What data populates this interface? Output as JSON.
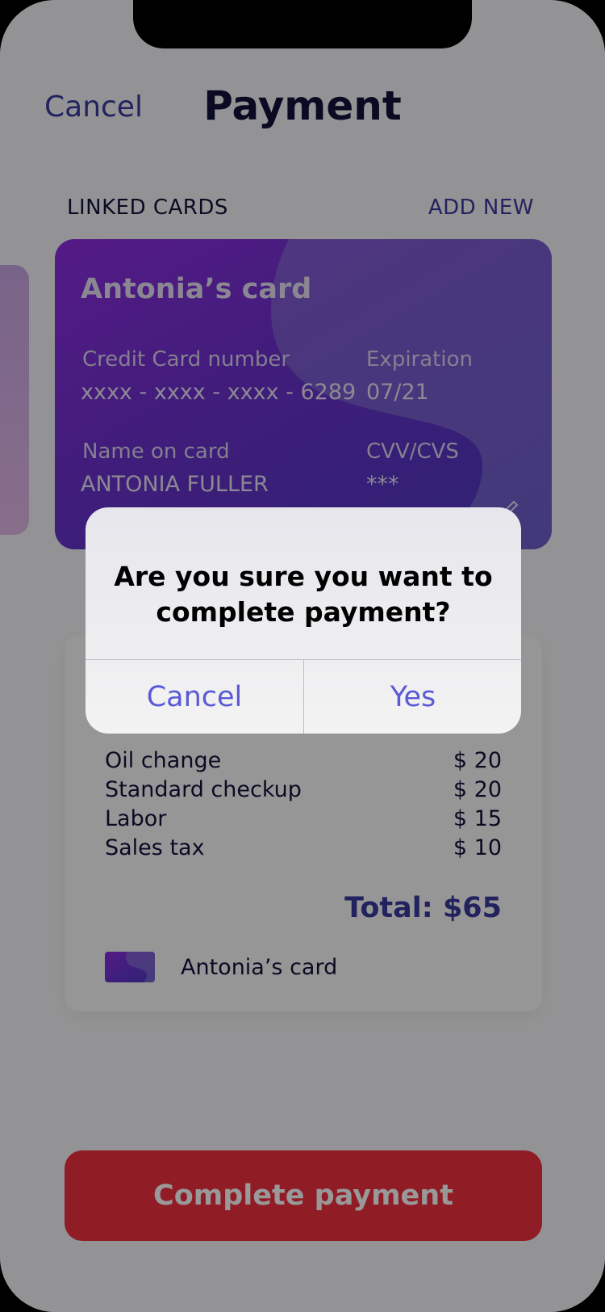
{
  "header": {
    "cancel_label": "Cancel",
    "title": "Payment"
  },
  "linked_cards": {
    "section_label": "LINKED CARDS",
    "add_new_label": "ADD NEW",
    "card": {
      "name": "Antonia’s card",
      "number_label": "Credit Card number",
      "number_value": "xxxx - xxxx - xxxx - 6289",
      "expiration_label": "Expiration",
      "expiration_value": "07/21",
      "holder_label": "Name on card",
      "holder_value": "ANTONIA FULLER",
      "cvv_label": "CVV/CVS",
      "cvv_value": "***",
      "edit_icon": "pencil-icon"
    }
  },
  "summary": {
    "items": [
      {
        "label": "Oil change",
        "amount": "$ 20"
      },
      {
        "label": "Standard checkup",
        "amount": "$ 20"
      },
      {
        "label": "Labor",
        "amount": "$ 15"
      },
      {
        "label": "Sales tax",
        "amount": "$ 10"
      }
    ],
    "total": "Total: $65",
    "payment_card": "Antonia’s card"
  },
  "complete_button": "Complete payment",
  "alert": {
    "message": "Are you sure you want to complete payment?",
    "cancel_label": "Cancel",
    "yes_label": "Yes"
  },
  "colors": {
    "accent": "#3a3a9e",
    "primary_button": "#f03040",
    "alert_action": "#5a5ad6",
    "card_gradient_start": "#8d2ce0",
    "card_gradient_end": "#4b3bc0"
  }
}
